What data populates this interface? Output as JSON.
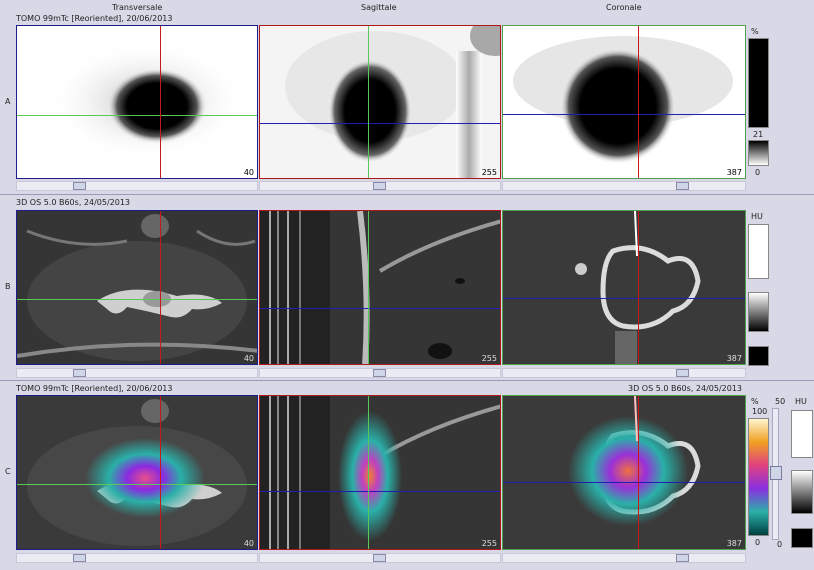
{
  "columns": [
    "Transversale",
    "Sagittale",
    "Coronale"
  ],
  "rows": [
    {
      "label": "A",
      "header_left": "TOMO 99mTc [Reoriented], 20/06/2013",
      "header_right": ""
    },
    {
      "label": "B",
      "header_left": "3D  OS  5.0  B60s, 24/05/2013",
      "header_right": ""
    },
    {
      "label": "C",
      "header_left": "TOMO 99mTc [Reoriented], 20/06/2013",
      "header_right": "3D  OS  5.0  B60s, 24/05/2013"
    }
  ],
  "slices": {
    "transversale": "40",
    "sagittale": "255",
    "coronale": "387"
  },
  "scales": {
    "pct_unit": "%",
    "a_value": "21",
    "a_min": "0",
    "hu_unit": "HU",
    "c_pct_unit": "%",
    "c_pct_max": "100",
    "c_pct_min": "0",
    "c_slider_label": "50",
    "c_slider_min": "0",
    "c_hu_unit": "HU"
  },
  "colors": {
    "crosshair_red": "#c81818",
    "crosshair_green": "#58c858",
    "crosshair_blue": "#2020b0"
  }
}
